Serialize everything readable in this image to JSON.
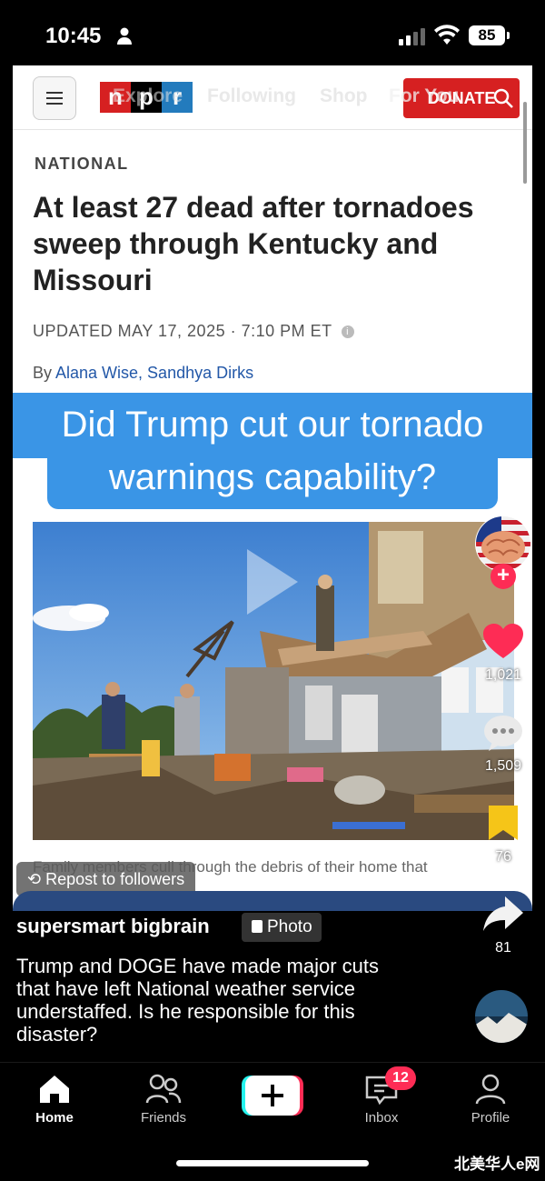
{
  "status": {
    "time": "10:45",
    "battery": "85"
  },
  "header": {
    "logo_letters": [
      "n",
      "p",
      "r"
    ],
    "nav_ghost": [
      "Explore",
      "Following",
      "Shop",
      "For You"
    ],
    "donate_label": "DONATE"
  },
  "article": {
    "section": "NATIONAL",
    "headline": "At least 27 dead after tornadoes sweep through Kentucky and Missouri",
    "updated": "UPDATED MAY 17, 2025 · 7:10 PM ET",
    "byline_prefix": "By ",
    "authors": "Alana Wise, Sandhya Dirks",
    "caption": "Family members cull through the debris of their home that"
  },
  "overlay": {
    "line1": "Did Trump cut our tornado",
    "line2": "warnings capability?"
  },
  "actions": {
    "likes": "1,021",
    "comments": "1,509",
    "saves": "76",
    "shares": "81"
  },
  "post": {
    "repost_label": "Repost to followers",
    "author": "supersmart bigbrain",
    "photo_tag": "Photo",
    "description": "Trump and DOGE have made major cuts that have left National weather service understaffed. Is he responsible for this disaster?"
  },
  "tabs": {
    "home": "Home",
    "friends": "Friends",
    "inbox": "Inbox",
    "profile": "Profile",
    "inbox_badge": "12"
  },
  "watermark": "北美华人e网",
  "colors": {
    "npr_red": "#d62021",
    "npr_black": "#000000",
    "npr_blue": "#237bbd",
    "overlay_blue": "#3a95e6",
    "like_red": "#fe2c55",
    "save_yellow": "#f5c518"
  }
}
